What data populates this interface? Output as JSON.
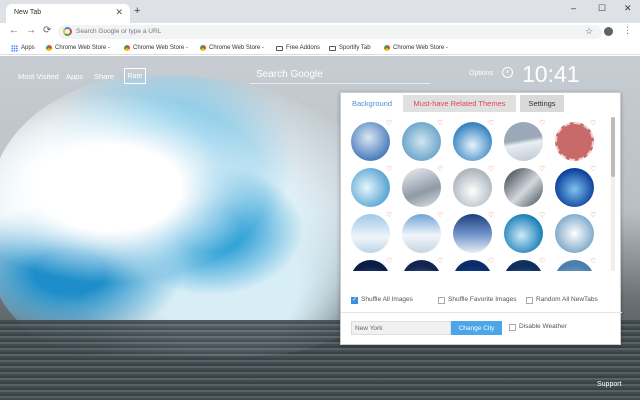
{
  "browser": {
    "tab_title": "New Tab",
    "tab_close": "✕",
    "new_tab": "+",
    "win_minimize": "–",
    "win_maximize": "☐",
    "win_close": "✕",
    "back": "←",
    "forward": "→",
    "reload": "⟳",
    "omnibox_placeholder": "Search Google or type a URL",
    "star": "☆",
    "menu": "⋮"
  },
  "bookmarks": [
    {
      "label": "Apps",
      "icon": "apps-grid-icon"
    },
    {
      "label": "Chrome Web Store -",
      "icon": "webstore-icon"
    },
    {
      "label": "Chrome Web Store -",
      "icon": "webstore-icon"
    },
    {
      "label": "Chrome Web Store -",
      "icon": "webstore-icon"
    },
    {
      "label": "Free Addons",
      "icon": "page-icon"
    },
    {
      "label": "Sportify Tab",
      "icon": "page-icon"
    },
    {
      "label": "Chrome Web Store -",
      "icon": "webstore-icon"
    }
  ],
  "page": {
    "links": [
      "Most Visited",
      "Apps",
      "Share"
    ],
    "rate": "Rate",
    "search_placeholder": "Search Google",
    "options": "Options",
    "time": "10:41",
    "support": "Support"
  },
  "panel": {
    "tabs": [
      "Background",
      "Must-have Related Themes",
      "Settings"
    ],
    "heart": "♡",
    "shuffle_all": "Shuffle All Images",
    "shuffle_fav": "Shuffle Favorite Images",
    "random_all": "Random All NewTabs",
    "city_value": "New York",
    "change_city": "Change City",
    "disable_weather": "Disable Weather"
  }
}
